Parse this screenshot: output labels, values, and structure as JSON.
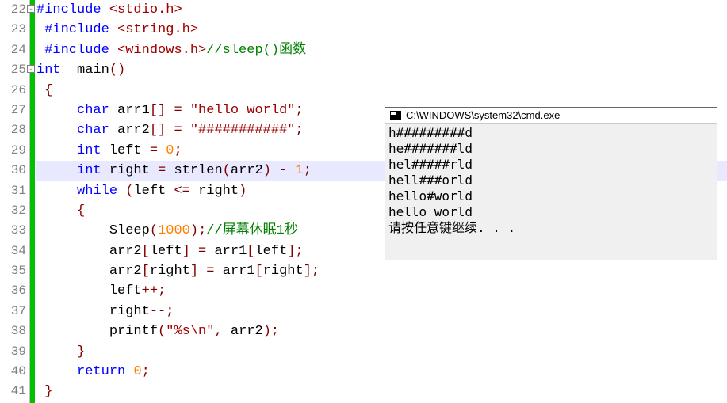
{
  "editor": {
    "line_numbers": [
      "22",
      "23",
      "24",
      "25",
      "26",
      "27",
      "28",
      "29",
      "30",
      "31",
      "32",
      "33",
      "34",
      "35",
      "36",
      "37",
      "38",
      "39",
      "40",
      "41"
    ],
    "highlighted_line_index": 8,
    "fold_markers": [
      0,
      3
    ],
    "lines": [
      {
        "segments": [
          {
            "t": "#include ",
            "c": "pp"
          },
          {
            "t": "<stdio.h>",
            "c": "inc"
          }
        ]
      },
      {
        "indent": " ",
        "segments": [
          {
            "t": "#include ",
            "c": "pp"
          },
          {
            "t": "<string.h>",
            "c": "inc"
          }
        ]
      },
      {
        "indent": " ",
        "segments": [
          {
            "t": "#include ",
            "c": "pp"
          },
          {
            "t": "<windows.h>",
            "c": "inc"
          },
          {
            "t": "//sleep()函数",
            "c": "cmt"
          }
        ]
      },
      {
        "segments": [
          {
            "t": "int  ",
            "c": "kw"
          },
          {
            "t": "main",
            "c": "fn"
          },
          {
            "t": "()",
            "c": "op"
          }
        ]
      },
      {
        "indent": " ",
        "segments": [
          {
            "t": "{",
            "c": "op"
          }
        ]
      },
      {
        "indent": "     ",
        "segments": [
          {
            "t": "char ",
            "c": "ty"
          },
          {
            "t": "arr1",
            "c": "id"
          },
          {
            "t": "[] = ",
            "c": "op"
          },
          {
            "t": "\"hello world\"",
            "c": "str"
          },
          {
            "t": ";",
            "c": "op"
          }
        ]
      },
      {
        "indent": "     ",
        "segments": [
          {
            "t": "char ",
            "c": "ty"
          },
          {
            "t": "arr2",
            "c": "id"
          },
          {
            "t": "[] = ",
            "c": "op"
          },
          {
            "t": "\"###########\"",
            "c": "str"
          },
          {
            "t": ";",
            "c": "op"
          }
        ]
      },
      {
        "indent": "     ",
        "segments": [
          {
            "t": "int ",
            "c": "ty"
          },
          {
            "t": "left",
            "c": "id"
          },
          {
            "t": " = ",
            "c": "op"
          },
          {
            "t": "0",
            "c": "num"
          },
          {
            "t": ";",
            "c": "op"
          }
        ]
      },
      {
        "indent": "     ",
        "segments": [
          {
            "t": "int ",
            "c": "ty"
          },
          {
            "t": "right",
            "c": "id"
          },
          {
            "t": " = ",
            "c": "op"
          },
          {
            "t": "strlen",
            "c": "fn"
          },
          {
            "t": "(",
            "c": "op"
          },
          {
            "t": "arr2",
            "c": "id"
          },
          {
            "t": ") - ",
            "c": "op"
          },
          {
            "t": "1",
            "c": "num"
          },
          {
            "t": ";",
            "c": "op"
          }
        ]
      },
      {
        "indent": "     ",
        "segments": [
          {
            "t": "while ",
            "c": "kw"
          },
          {
            "t": "(",
            "c": "op"
          },
          {
            "t": "left",
            "c": "id"
          },
          {
            "t": " <= ",
            "c": "op"
          },
          {
            "t": "right",
            "c": "id"
          },
          {
            "t": ")",
            "c": "op"
          }
        ]
      },
      {
        "indent": "     ",
        "segments": [
          {
            "t": "{",
            "c": "op"
          }
        ]
      },
      {
        "indent": "         ",
        "segments": [
          {
            "t": "Sleep",
            "c": "fn"
          },
          {
            "t": "(",
            "c": "op"
          },
          {
            "t": "1000",
            "c": "num"
          },
          {
            "t": ")",
            "c": "op"
          },
          {
            "t": ";",
            "c": "op"
          },
          {
            "t": "//屏幕休眠1秒",
            "c": "cmt"
          }
        ]
      },
      {
        "indent": "         ",
        "segments": [
          {
            "t": "arr2",
            "c": "id"
          },
          {
            "t": "[",
            "c": "op"
          },
          {
            "t": "left",
            "c": "id"
          },
          {
            "t": "] = ",
            "c": "op"
          },
          {
            "t": "arr1",
            "c": "id"
          },
          {
            "t": "[",
            "c": "op"
          },
          {
            "t": "left",
            "c": "id"
          },
          {
            "t": "];",
            "c": "op"
          }
        ]
      },
      {
        "indent": "         ",
        "segments": [
          {
            "t": "arr2",
            "c": "id"
          },
          {
            "t": "[",
            "c": "op"
          },
          {
            "t": "right",
            "c": "id"
          },
          {
            "t": "] = ",
            "c": "op"
          },
          {
            "t": "arr1",
            "c": "id"
          },
          {
            "t": "[",
            "c": "op"
          },
          {
            "t": "right",
            "c": "id"
          },
          {
            "t": "];",
            "c": "op"
          }
        ]
      },
      {
        "indent": "         ",
        "segments": [
          {
            "t": "left",
            "c": "id"
          },
          {
            "t": "++;",
            "c": "op"
          }
        ]
      },
      {
        "indent": "         ",
        "segments": [
          {
            "t": "right",
            "c": "id"
          },
          {
            "t": "--;",
            "c": "op"
          }
        ]
      },
      {
        "indent": "         ",
        "segments": [
          {
            "t": "printf",
            "c": "fn"
          },
          {
            "t": "(",
            "c": "op"
          },
          {
            "t": "\"%s\\n\"",
            "c": "str"
          },
          {
            "t": ", ",
            "c": "op"
          },
          {
            "t": "arr2",
            "c": "id"
          },
          {
            "t": ");",
            "c": "op"
          }
        ]
      },
      {
        "indent": "     ",
        "segments": [
          {
            "t": "}",
            "c": "op"
          }
        ]
      },
      {
        "indent": "     ",
        "segments": [
          {
            "t": "return ",
            "c": "kw"
          },
          {
            "t": "0",
            "c": "num"
          },
          {
            "t": ";",
            "c": "op"
          }
        ]
      },
      {
        "indent": " ",
        "segments": [
          {
            "t": "}",
            "c": "op"
          }
        ]
      }
    ]
  },
  "terminal": {
    "title": "C:\\WINDOWS\\system32\\cmd.exe",
    "output": [
      "h#########d",
      "he#######ld",
      "hel#####rld",
      "hell###orld",
      "hello#world",
      "hello world",
      "请按任意键继续. . ."
    ]
  }
}
